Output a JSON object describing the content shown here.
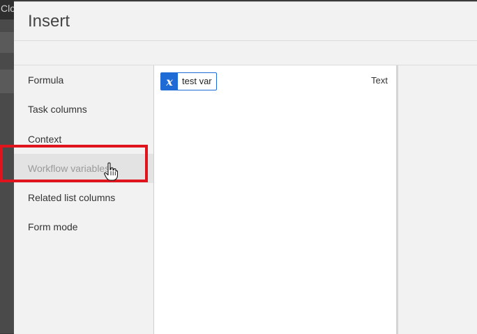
{
  "background": {
    "title_fragment": "Clo"
  },
  "dialog": {
    "title": "Insert",
    "nav_items": [
      {
        "id": "formula",
        "label": "Formula"
      },
      {
        "id": "task-columns",
        "label": "Task columns"
      },
      {
        "id": "context",
        "label": "Context"
      },
      {
        "id": "workflow-variables",
        "label": "Workflow variables",
        "active": true
      },
      {
        "id": "related-list-columns",
        "label": "Related list columns"
      },
      {
        "id": "form-mode",
        "label": "Form mode"
      }
    ],
    "variables": [
      {
        "name": "test var",
        "type": "Text",
        "icon": "variable-x-icon"
      }
    ]
  },
  "colors": {
    "accent": "#1e6bd6",
    "highlight": "#e0141d"
  }
}
